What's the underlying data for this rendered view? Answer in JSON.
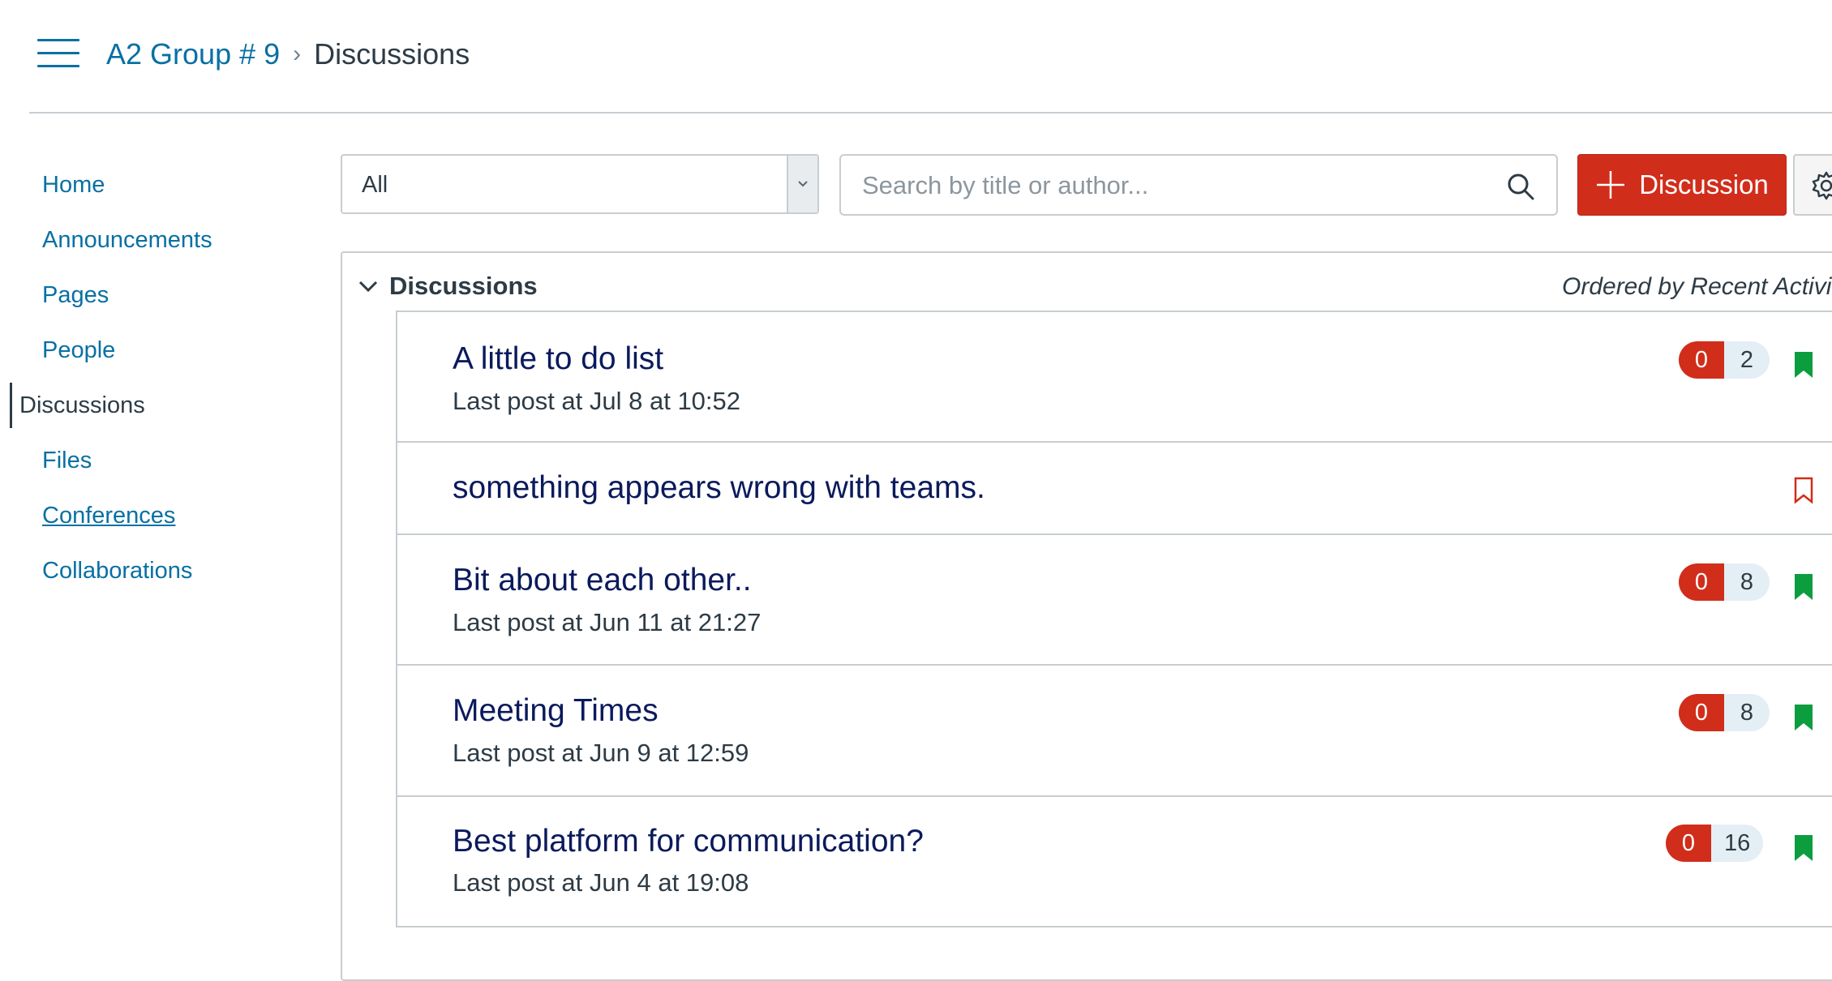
{
  "header": {
    "menu_icon": "hamburger-icon",
    "breadcrumb": {
      "course": "A2 Group # 9",
      "separator": "›",
      "current": "Discussions"
    }
  },
  "nav": {
    "items": [
      {
        "label": "Home"
      },
      {
        "label": "Announcements"
      },
      {
        "label": "Pages"
      },
      {
        "label": "People"
      },
      {
        "label": "Discussions",
        "active": true
      },
      {
        "label": "Files"
      },
      {
        "label": "Conferences"
      },
      {
        "label": "Collaborations"
      }
    ]
  },
  "toolbar": {
    "filter": {
      "value": "All"
    },
    "search": {
      "placeholder": "Search by title or author..."
    },
    "add_button_label": "Discussion",
    "settings_icon": "gear-icon"
  },
  "section": {
    "title": "Discussions",
    "ordered_by": "Ordered by Recent Activity"
  },
  "discussions": [
    {
      "title": "A little to do list",
      "meta": "Last post at Jul 8 at 10:52",
      "unread": "0",
      "total": "2",
      "bookmark": "filled"
    },
    {
      "title": "something appears wrong with teams.",
      "meta": "",
      "unread": "",
      "total": "",
      "bookmark": "outline"
    },
    {
      "title": "Bit about each other..",
      "meta": "Last post at Jun 11 at 21:27",
      "unread": "0",
      "total": "8",
      "bookmark": "filled"
    },
    {
      "title": "Meeting Times",
      "meta": "Last post at Jun 9 at 12:59",
      "unread": "0",
      "total": "8",
      "bookmark": "filled"
    },
    {
      "title": "Best platform for communication?",
      "meta": "Last post at Jun 4 at 19:08",
      "unread": "0",
      "total": "16",
      "bookmark": "filled"
    }
  ],
  "colors": {
    "link": "#0770a3",
    "title": "#0b1a5c",
    "danger": "#d12d1b",
    "bookmark_active": "#0b9d3e",
    "border": "#c7cdd1"
  }
}
